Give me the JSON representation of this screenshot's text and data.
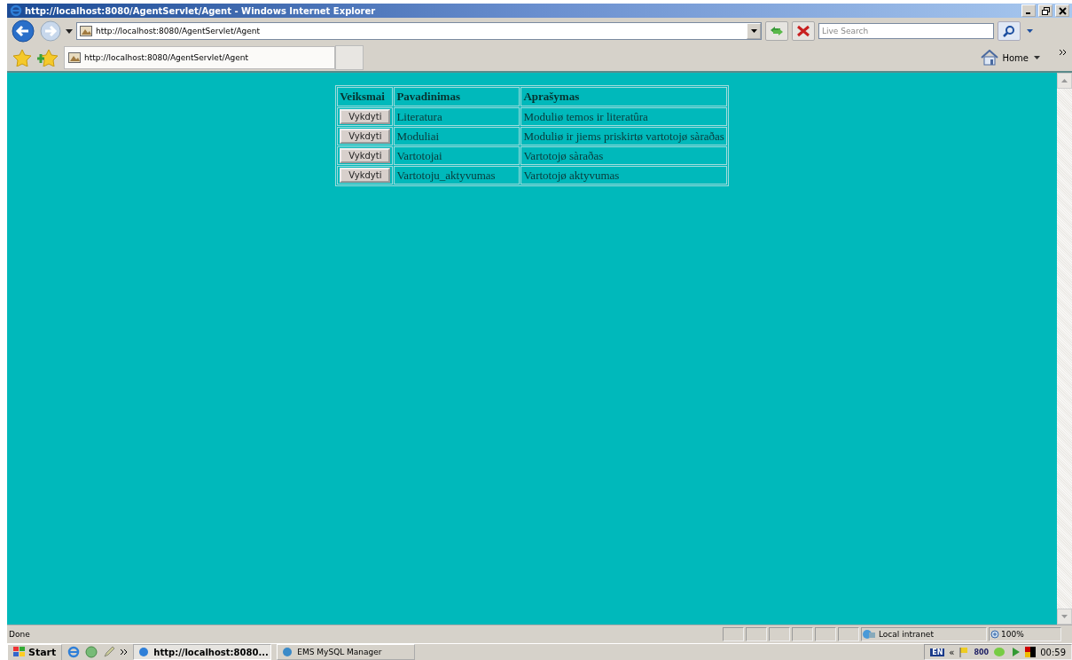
{
  "window": {
    "title": "http://localhost:8080/AgentServlet/Agent - Windows Internet Explorer"
  },
  "address_bar": {
    "url": "http://localhost:8080/AgentServlet/Agent"
  },
  "search": {
    "placeholder": "Live Search"
  },
  "tabs": [
    {
      "title": "http://localhost:8080/AgentServlet/Agent",
      "selected": true
    }
  ],
  "command_bar": {
    "home": "Home"
  },
  "table": {
    "columns": [
      "Veiksmai",
      "Pavadinimas",
      "Aprašymas"
    ],
    "rows": [
      {
        "action": "Vykdyti",
        "name": "Literatura",
        "description": "Moduliø temos ir literatûra"
      },
      {
        "action": "Vykdyti",
        "name": "Moduliai",
        "description": "Moduliø ir jiems priskirtø vartotojø sàraðas"
      },
      {
        "action": "Vykdyti",
        "name": "Vartotojai",
        "description": "Vartotojø sàraðas"
      },
      {
        "action": "Vykdyti",
        "name": "Vartotoju_aktyvumas",
        "description": "Vartotojø aktyvumas"
      }
    ]
  },
  "status_bar": {
    "text": "Done",
    "zone": "Local intranet",
    "zoom": "100%"
  },
  "taskbar": {
    "start": "Start",
    "tasks": [
      {
        "label": "http://localhost:8080...",
        "selected": true
      },
      {
        "label": "EMS MySQL Manager",
        "selected": false
      }
    ],
    "tray": {
      "language": "EN",
      "collapse": "«",
      "badge": "800",
      "clock": "00:59"
    }
  }
}
